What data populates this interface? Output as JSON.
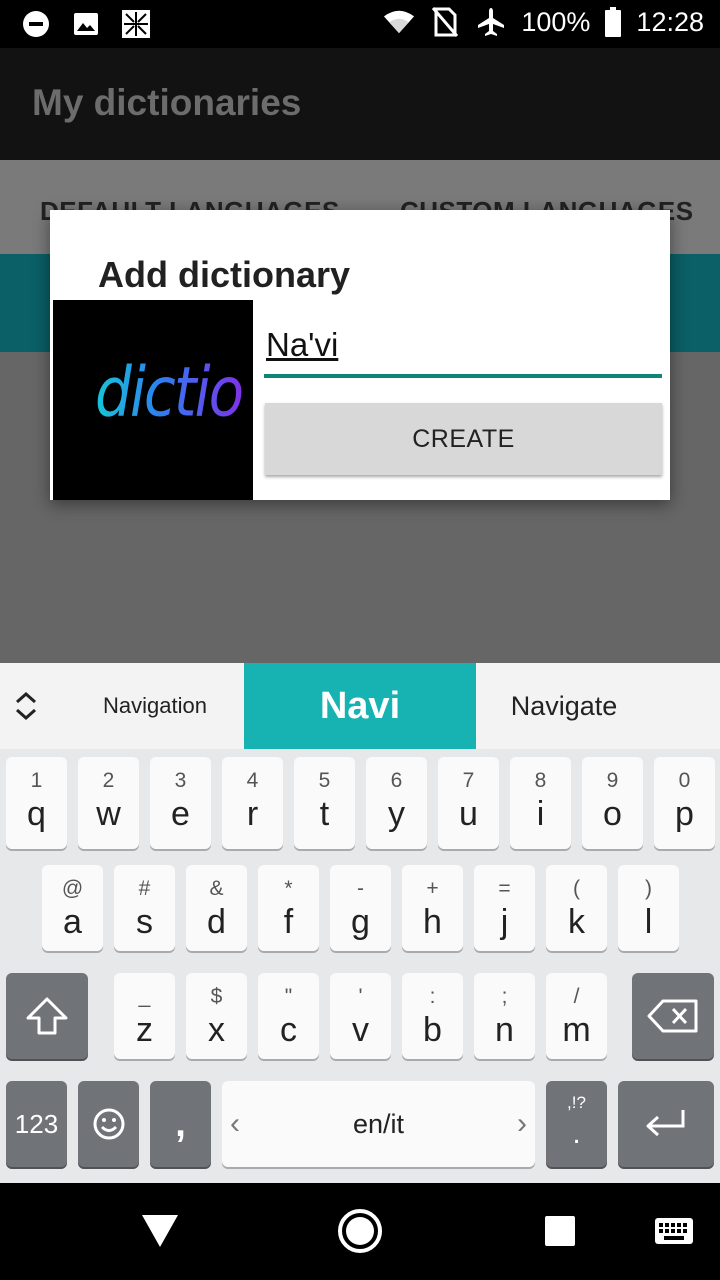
{
  "status_bar": {
    "icons_left": [
      "do-not-disturb-icon",
      "image-icon",
      "photo-app-icon"
    ],
    "icons_right": [
      "wifi-icon",
      "no-sim-icon",
      "airplane-mode-icon"
    ],
    "battery": "100%",
    "time": "12:28"
  },
  "app_bar": {
    "title": "My dictionaries"
  },
  "tabs": [
    {
      "label": "DEFAULT LANGUAGES"
    },
    {
      "label": "CUSTOM LANGUAGES"
    }
  ],
  "dialog": {
    "title": "Add dictionary",
    "logo_text": "dictio",
    "name_value": "Na'vi",
    "create_label": "CREATE",
    "accent_color": "#0f8578"
  },
  "keyboard": {
    "suggestions": [
      "Navigation",
      "Navi",
      "Navigate"
    ],
    "suggestion_highlight_color": "#17b2b2",
    "row1": [
      {
        "hint": "1",
        "key": "q"
      },
      {
        "hint": "2",
        "key": "w"
      },
      {
        "hint": "3",
        "key": "e"
      },
      {
        "hint": "4",
        "key": "r"
      },
      {
        "hint": "5",
        "key": "t"
      },
      {
        "hint": "6",
        "key": "y"
      },
      {
        "hint": "7",
        "key": "u"
      },
      {
        "hint": "8",
        "key": "i"
      },
      {
        "hint": "9",
        "key": "o"
      },
      {
        "hint": "0",
        "key": "p"
      }
    ],
    "row2": [
      {
        "hint": "@",
        "key": "a"
      },
      {
        "hint": "#",
        "key": "s"
      },
      {
        "hint": "&",
        "key": "d"
      },
      {
        "hint": "*",
        "key": "f"
      },
      {
        "hint": "-",
        "key": "g"
      },
      {
        "hint": "+",
        "key": "h"
      },
      {
        "hint": "=",
        "key": "j"
      },
      {
        "hint": "(",
        "key": "k"
      },
      {
        "hint": ")",
        "key": "l"
      }
    ],
    "row3": [
      {
        "hint": "_",
        "key": "z"
      },
      {
        "hint": "$",
        "key": "x"
      },
      {
        "hint": "\"",
        "key": "c"
      },
      {
        "hint": "'",
        "key": "v"
      },
      {
        "hint": ":",
        "key": "b"
      },
      {
        "hint": ";",
        "key": "n"
      },
      {
        "hint": "/",
        "key": "m"
      }
    ],
    "symbols_label": "123",
    "comma_label": ",",
    "space_label": "en/it",
    "punct_hint": ",!?",
    "punct_key": "."
  },
  "nav_bar": {
    "icons": [
      "back-icon",
      "home-icon",
      "recents-icon",
      "keyboard-switch-icon"
    ]
  }
}
